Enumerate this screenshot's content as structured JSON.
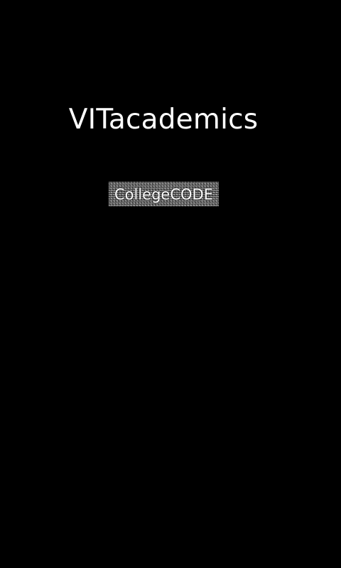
{
  "app": {
    "title": "VITacademics",
    "publisher_badge": "CollegeCODE"
  },
  "colors": {
    "background": "#000000",
    "text": "#ffffff",
    "badge_texture": "#6e6e6e"
  }
}
